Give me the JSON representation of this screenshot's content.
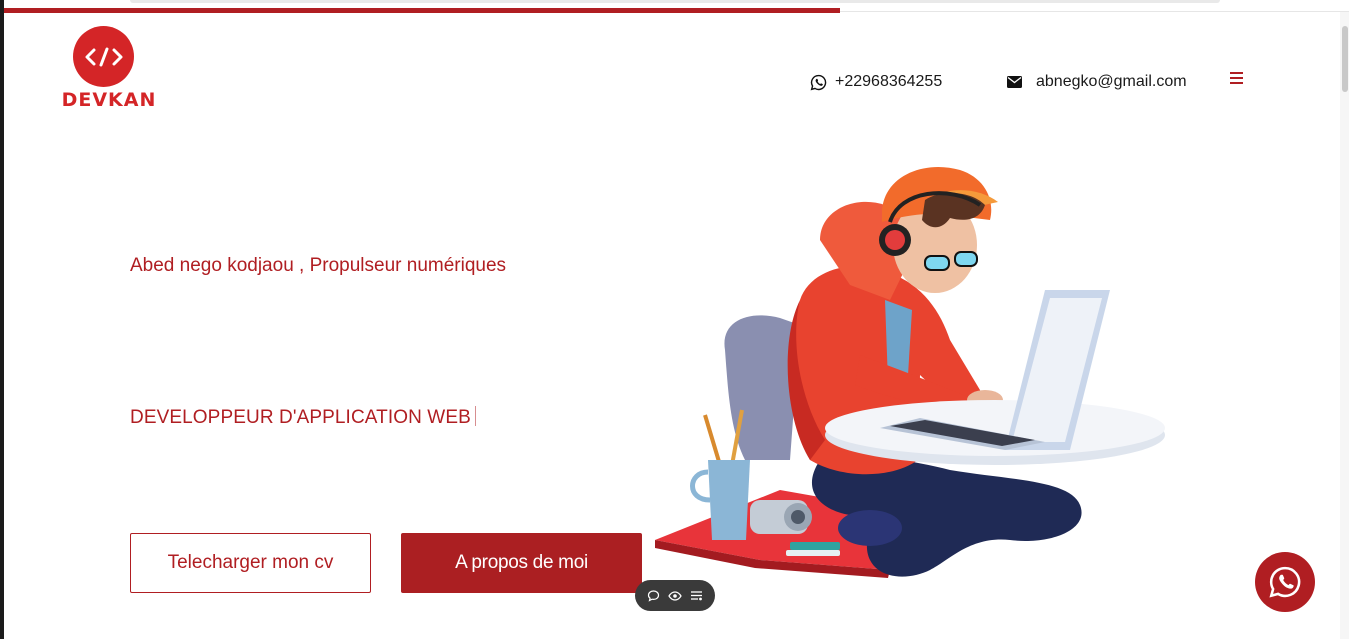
{
  "brand": {
    "logo_text": "DEVKAN",
    "logo_symbol": "</>",
    "color": "#d42527"
  },
  "header": {
    "phone": {
      "icon": "whatsapp-icon",
      "text": "+22968364255"
    },
    "email": {
      "icon": "envelope-icon",
      "text": "abnegko@gmail.com"
    },
    "menu_icon": "hamburger-menu-icon"
  },
  "hero": {
    "subtitle": "Abed nego kodjaou , Propulseur numériques",
    "title": "DEVELOPPEUR D'APPLICATION WEB",
    "buttons": {
      "download_cv": "Telecharger mon cv",
      "about": "A propos de moi"
    }
  },
  "floating_toolbar": {
    "icons": [
      "comment-icon",
      "eye-icon",
      "settings-list-icon"
    ]
  },
  "whatsapp_button": {
    "icon": "whatsapp-icon"
  },
  "colors": {
    "accent": "#b01e22",
    "accent_bright": "#d42527",
    "text": "#1a1a1a"
  }
}
